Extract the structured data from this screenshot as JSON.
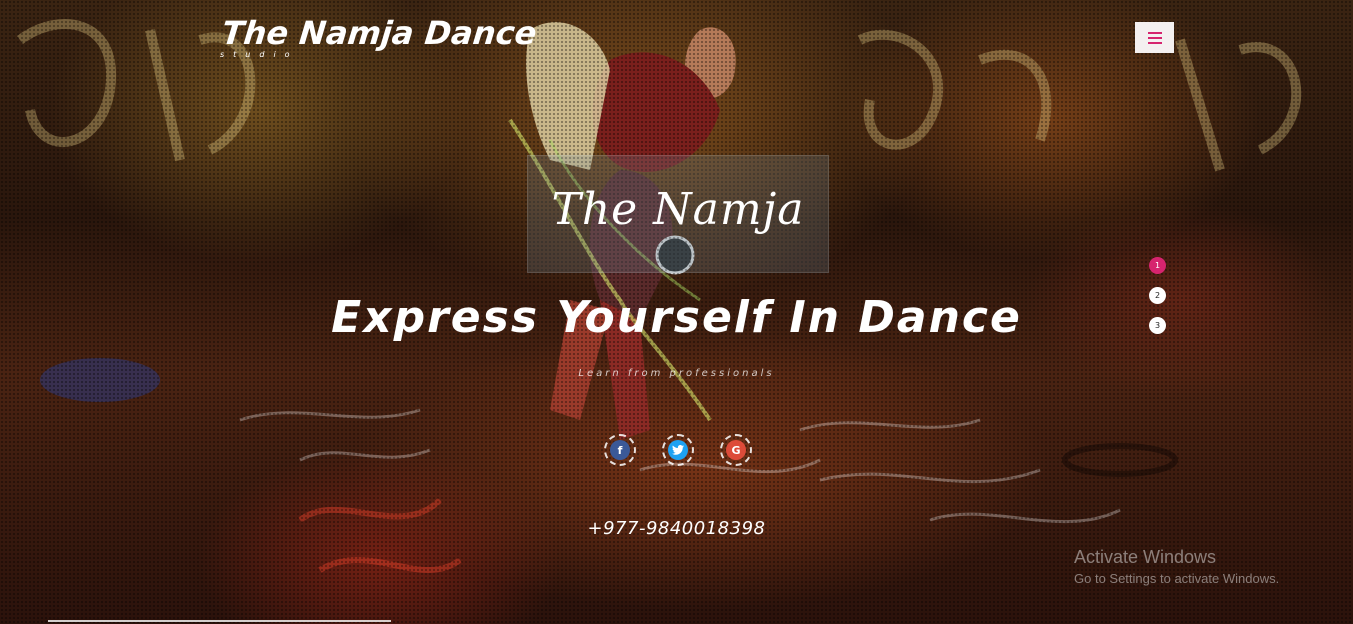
{
  "header": {
    "logo_title": "The Namja Dance",
    "logo_subtitle": "studio",
    "menu_icon": "hamburger-icon"
  },
  "hero": {
    "brand": "The Namja",
    "headline": "Express Yourself In Dance",
    "tagline": "Learn from professionals",
    "phone": "+977-9840018398"
  },
  "slider_nav": {
    "dots": [
      "1",
      "2",
      "3"
    ],
    "active_index": 0
  },
  "socials": [
    {
      "name": "facebook-icon",
      "glyph": "f",
      "color": "#3b5998"
    },
    {
      "name": "twitter-icon",
      "glyph": "t",
      "color": "#1da1f2"
    },
    {
      "name": "google-plus-icon",
      "glyph": "G",
      "color": "#dd4b39"
    }
  ],
  "watermark": {
    "line1": "Activate Windows",
    "line2": "Go to Settings to activate Windows."
  },
  "colors": {
    "accent": "#d6246e"
  }
}
